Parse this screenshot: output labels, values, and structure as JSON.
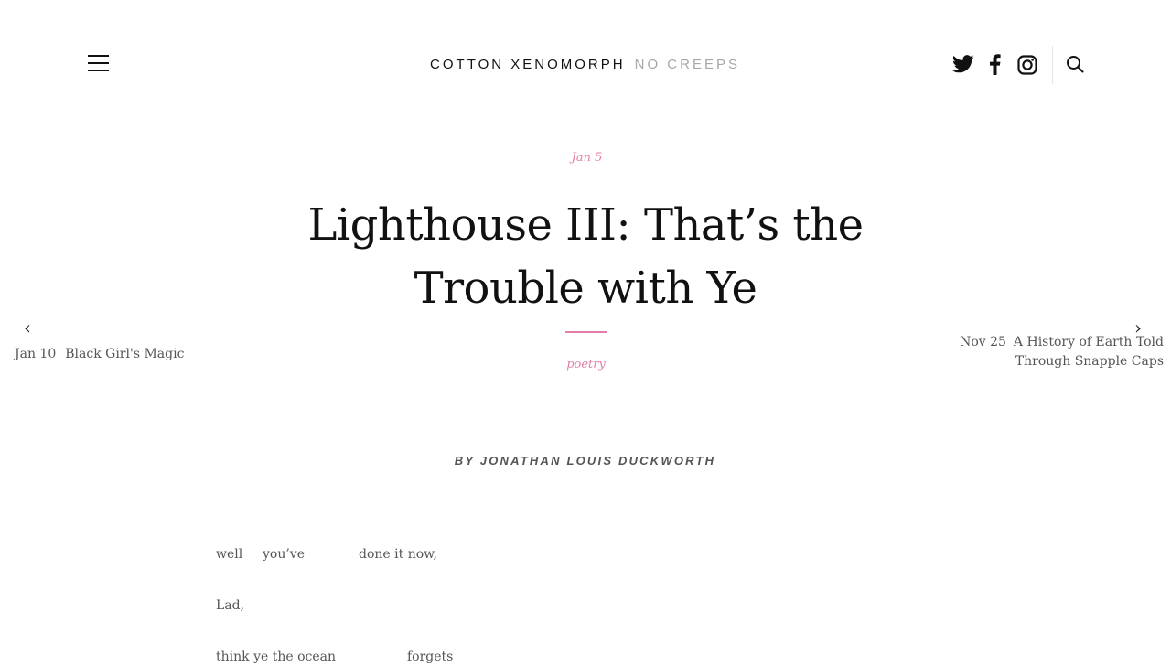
{
  "header": {
    "brand_primary": "COTTON XENOMORPH",
    "brand_secondary": "NO CREEPS",
    "icons": [
      "menu-icon",
      "twitter-icon",
      "facebook-icon",
      "instagram-icon",
      "search-icon"
    ]
  },
  "article": {
    "date": "Jan 5",
    "title_line1": "Lighthouse III: That’s the",
    "title_line2": "Trouble with Ye",
    "category": "poetry",
    "byline": "BY JONATHAN LOUIS DUCKWORTH"
  },
  "nav": {
    "prev_arrow": "‹",
    "next_arrow": "›",
    "prev": {
      "date": "Jan 10",
      "title": "Black Girl's Magic"
    },
    "next": {
      "date": "Nov 25",
      "title_line1": "A History of Earth Told",
      "title_line2": "Through Snapple Caps"
    }
  },
  "poem": {
    "words": [
      "well",
      "you’ve",
      "done it now,",
      "Lad,",
      "think ye the ocean",
      "forgets"
    ]
  },
  "colors": {
    "accent": "#e27fa8",
    "muted": "#a7a7a7",
    "text": "#111111"
  }
}
